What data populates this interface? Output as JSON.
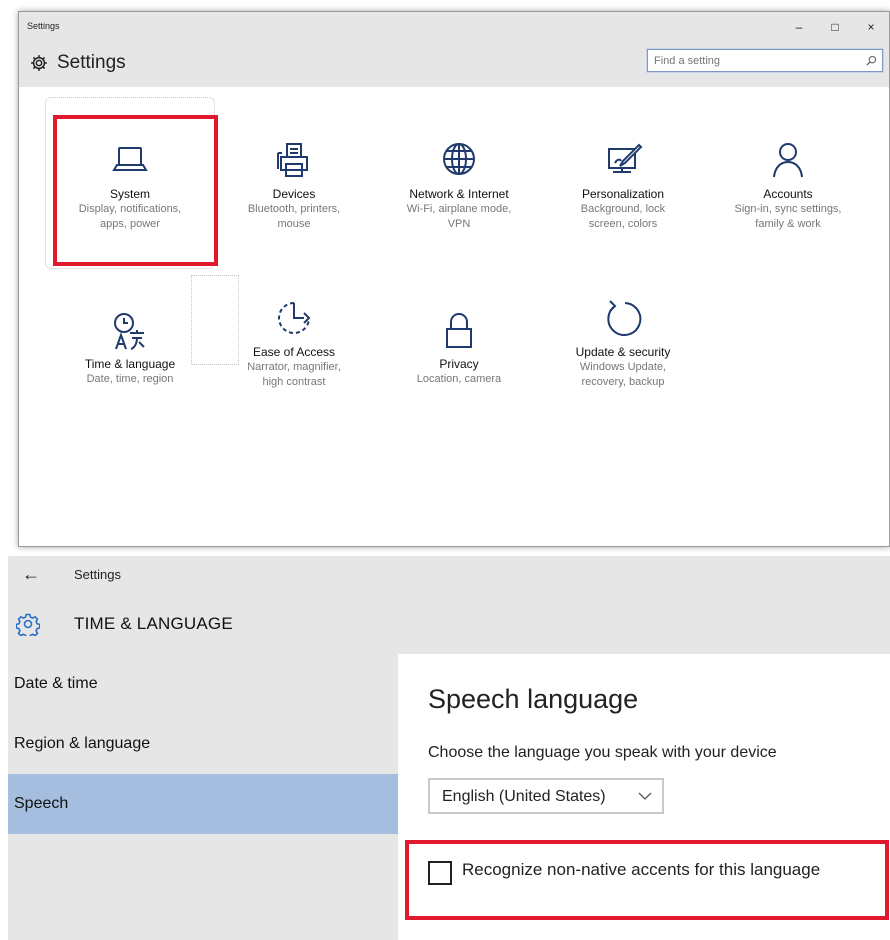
{
  "settings_window": {
    "titlebar_title": "Settings",
    "minimize_symbol": "–",
    "maximize_symbol": "□",
    "close_symbol": "×",
    "header_title": "Settings",
    "search_placeholder": "Find a setting",
    "tiles": [
      {
        "icon": "laptop-icon",
        "name": "System",
        "desc": "Display, notifications,\napps, power"
      },
      {
        "icon": "printer-icon",
        "name": "Devices",
        "desc": "Bluetooth, printers,\nmouse"
      },
      {
        "icon": "globe-icon",
        "name": "Network & Internet",
        "desc": "Wi-Fi, airplane mode,\nVPN"
      },
      {
        "icon": "paintbrush-icon",
        "name": "Personalization",
        "desc": "Background, lock\nscreen, colors"
      },
      {
        "icon": "person-icon",
        "name": "Accounts",
        "desc": "Sign-in, sync settings,\nfamily & work"
      },
      {
        "icon": "clock-language-icon",
        "name": "Time & language",
        "desc": "Date, time, region"
      },
      {
        "icon": "ease-of-access-icon",
        "name": "Ease of Access",
        "desc": "Narrator, magnifier,\nhigh contrast"
      },
      {
        "icon": "lock-icon",
        "name": "Privacy",
        "desc": "Location, camera"
      },
      {
        "icon": "refresh-icon",
        "name": "Update & security",
        "desc": "Windows Update,\nrecovery, backup"
      }
    ],
    "highlight_color": "#e01a2a"
  },
  "time_language_window": {
    "back_symbol": "←",
    "breadcrumb": "Settings",
    "section_title": "TIME & LANGUAGE",
    "nav_items": [
      "Date & time",
      "Region & language",
      "Speech"
    ],
    "active_nav": "Speech",
    "content": {
      "title": "Speech language",
      "label": "Choose the language you speak with your device",
      "dropdown_value": "English (United States)",
      "checkbox_label": "Recognize non-native accents for this language",
      "checkbox_checked": false
    },
    "accent_color": "#a5bedf"
  }
}
